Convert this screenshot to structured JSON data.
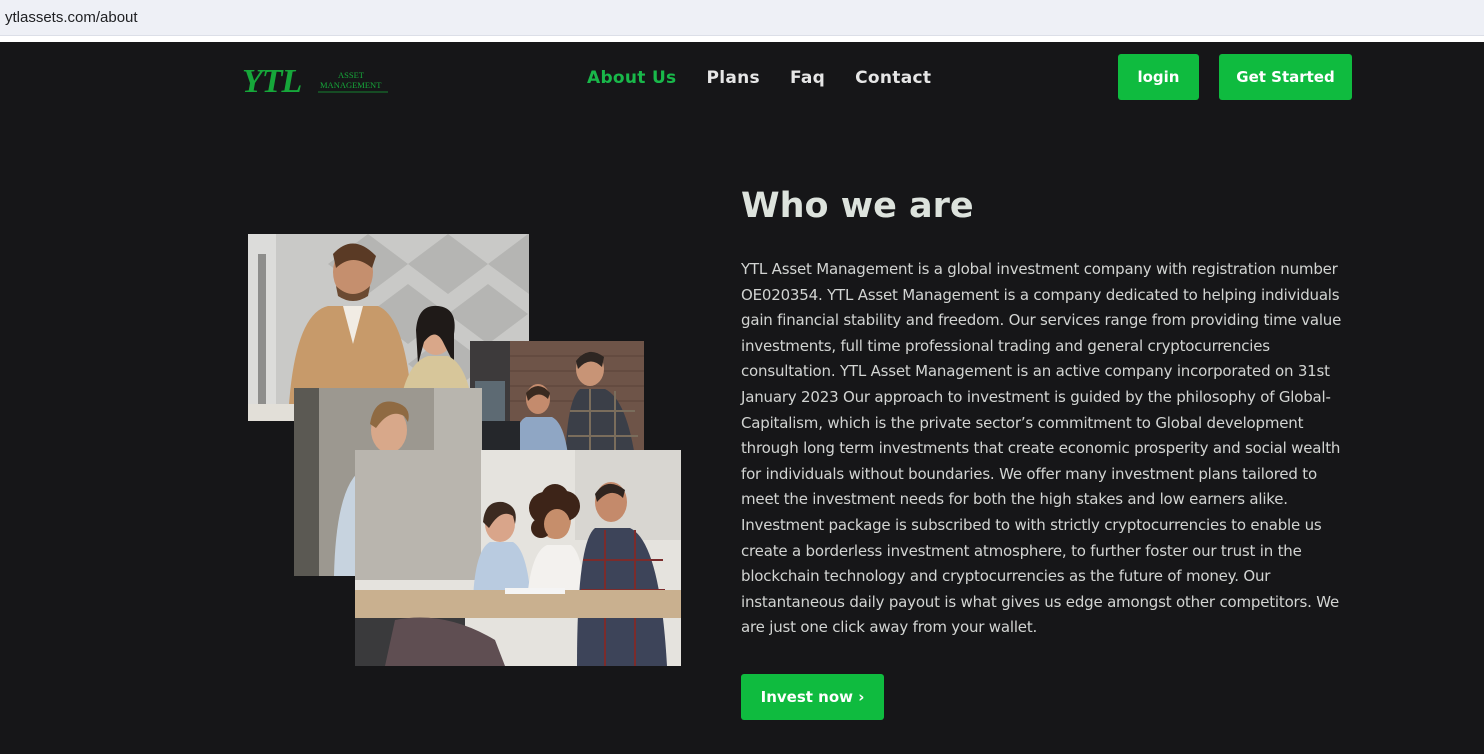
{
  "browser": {
    "url": "ytlassets.com/about"
  },
  "logo": {
    "main": "YTL",
    "sub_line1": "ASSET",
    "sub_line2": "MANAGEMENT"
  },
  "nav": {
    "items": [
      {
        "label": "About Us",
        "active": true
      },
      {
        "label": "Plans",
        "active": false
      },
      {
        "label": "Faq",
        "active": false
      },
      {
        "label": "Contact",
        "active": false
      }
    ]
  },
  "header_buttons": {
    "login": "login",
    "get_started": "Get Started"
  },
  "about": {
    "heading": "Who we are",
    "paragraph": "YTL Asset Management is a global investment company with registration number OE020354. YTL Asset Management is a company dedicated to helping individuals gain financial stability and freedom. Our services range from providing time value investments, full time professional trading and general cryptocurrencies consultation. YTL Asset Management is an active company incorporated on 31st January 2023 Our approach to investment is guided by the philosophy of Global-Capitalism, which is the private sector’s commitment to Global development through long term investments that create economic prosperity and social wealth for individuals without boundaries. We offer many investment plans tailored to meet the investment needs for both the high stakes and low earners alike. Investment package is subscribed to with strictly cryptocurrencies to enable us create a borderless investment atmosphere, to further foster our trust in the blockchain technology and cryptocurrencies as the future of money. Our instantaneous daily payout is what gives us edge amongst other competitors. We are just one click away from your wallet.",
    "cta": "Invest now ›"
  },
  "colors": {
    "background": "#161618",
    "accent": "#0fbb3f",
    "nav_active": "#19b84a",
    "heading": "#dde3dd"
  }
}
